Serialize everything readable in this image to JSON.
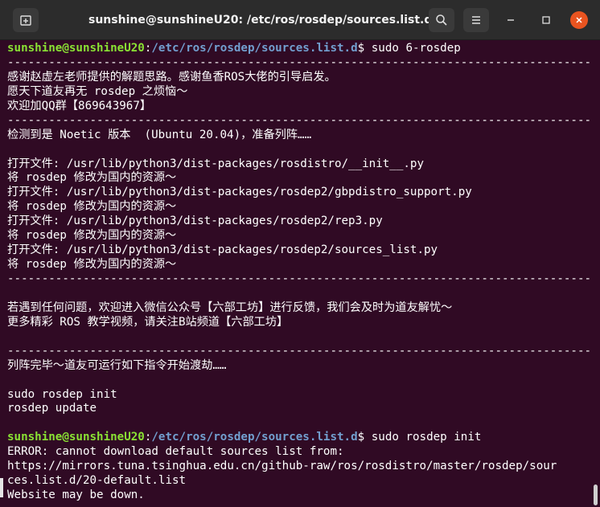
{
  "window": {
    "title": "sunshine@sunshineU20: /etc/ros/rosdep/sources.list.d"
  },
  "titlebar_icons": {
    "new_tab": "new-tab-icon",
    "search": "search-icon",
    "menu": "hamburger-menu-icon",
    "minimize": "minimize-icon",
    "maximize": "maximize-icon",
    "close": "close-icon"
  },
  "colors": {
    "terminal_bg": "#300a24",
    "titlebar_bg": "#2c2c2c",
    "prompt_user": "#8ae234",
    "prompt_path": "#729fcf",
    "close_button": "#e95420"
  },
  "terminal": {
    "prompt1": {
      "user": "sunshine@sunshineU20",
      "sep": ":",
      "path": "/etc/ros/rosdep/sources.list.d",
      "dollar": "$ ",
      "command": "sudo 6-rosdep"
    },
    "lines_a": [
      "------------------------------------------------------------------------------------------",
      "感谢赵虚左老师提供的解题思路。感谢鱼香ROS大佬的引导启发。",
      "愿天下道友再无 rosdep 之烦恼～",
      "欢迎加QQ群【869643967】",
      "------------------------------------------------------------------------------------------",
      "检测到是 Noetic 版本  (Ubuntu 20.04)，准备列阵……",
      "",
      "打开文件: /usr/lib/python3/dist-packages/rosdistro/__init__.py",
      "将 rosdep 修改为国内的资源～",
      "打开文件: /usr/lib/python3/dist-packages/rosdep2/gbpdistro_support.py",
      "将 rosdep 修改为国内的资源～",
      "打开文件: /usr/lib/python3/dist-packages/rosdep2/rep3.py",
      "将 rosdep 修改为国内的资源～",
      "打开文件: /usr/lib/python3/dist-packages/rosdep2/sources_list.py",
      "将 rosdep 修改为国内的资源～",
      "------------------------------------------------------------------------------------------",
      "",
      "若遇到任何问题，欢迎进入微信公众号【六部工坊】进行反馈，我们会及时为道友解忧～",
      "更多精彩 ROS 教学视频，请关注B站频道【六部工坊】",
      "",
      "------------------------------------------------------------------------------------------",
      "列阵完毕～道友可运行如下指令开始渡劫……",
      "",
      "sudo rosdep init",
      "rosdep update",
      ""
    ],
    "prompt2": {
      "user": "sunshine@sunshineU20",
      "sep": ":",
      "path": "/etc/ros/rosdep/sources.list.d",
      "dollar": "$ ",
      "command": "sudo rosdep init"
    },
    "lines_b": [
      "ERROR: cannot download default sources list from:",
      "https://mirrors.tuna.tsinghua.edu.cn/github-raw/ros/rosdistro/master/rosdep/sour",
      "ces.list.d/20-default.list",
      "Website may be down."
    ]
  }
}
